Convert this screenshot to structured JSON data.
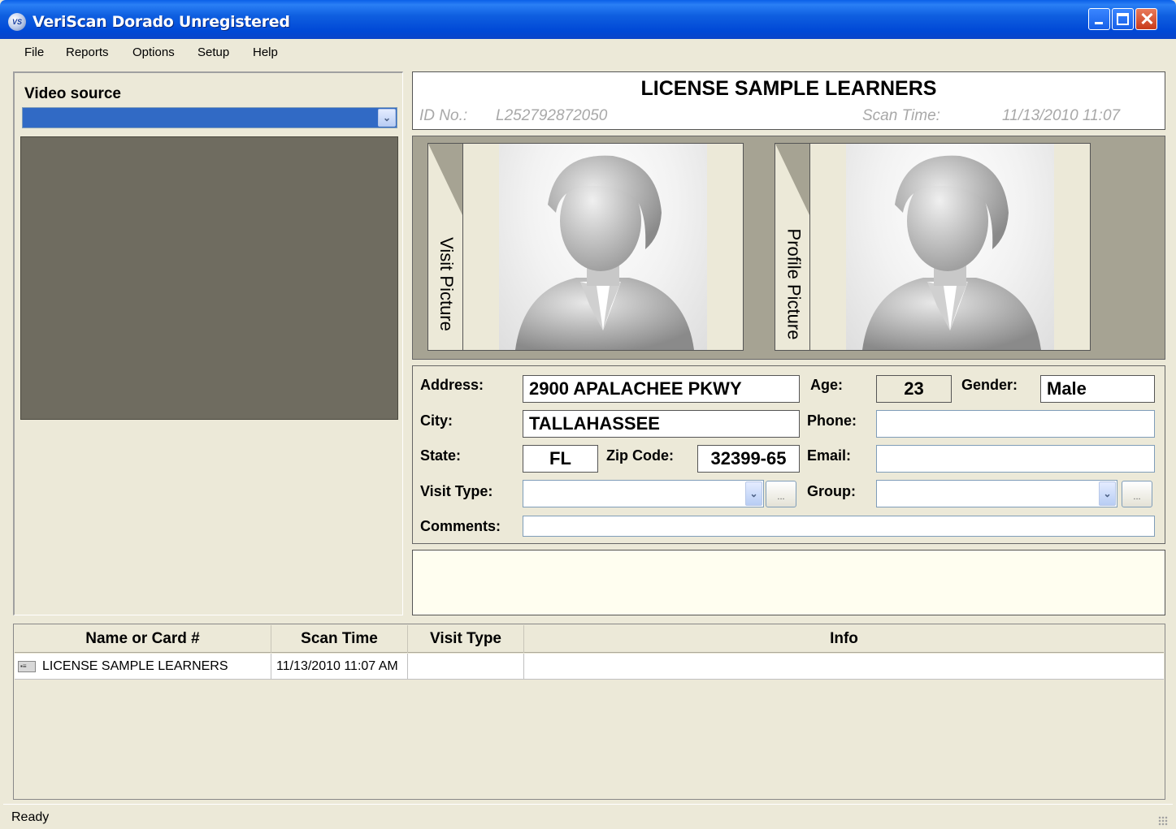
{
  "window": {
    "title": "VeriScan Dorado Unregistered",
    "icon_text": "VS",
    "icon": "app-logo-icon"
  },
  "menu": [
    "File",
    "Reports",
    "Options",
    "Setup",
    "Help"
  ],
  "video": {
    "label": "Video source",
    "selected": ""
  },
  "card": {
    "name": "LICENSE SAMPLE LEARNERS",
    "id_label": "ID No.:",
    "id_value": "L252792872050",
    "scan_label": "Scan Time:",
    "scan_value": "11/13/2010 11:07"
  },
  "pictures": {
    "visit_label": "Visit Picture",
    "profile_label": "Profile Picture"
  },
  "form": {
    "address_label": "Address:",
    "address_value": "2900 APALACHEE PKWY",
    "city_label": "City:",
    "city_value": "TALLAHASSEE",
    "state_label": "State:",
    "state_value": "FL",
    "zip_label": "Zip Code:",
    "zip_value": "32399-65",
    "age_label": "Age:",
    "age_value": "23",
    "gender_label": "Gender:",
    "gender_value": "Male",
    "phone_label": "Phone:",
    "phone_value": "",
    "email_label": "Email:",
    "email_value": "",
    "visit_type_label": "Visit Type:",
    "visit_type_value": "",
    "group_label": "Group:",
    "group_value": "",
    "comments_label": "Comments:",
    "comments_value": "",
    "dots": "..."
  },
  "list": {
    "columns": [
      "Name or Card #",
      "Scan Time",
      "Visit Type",
      "Info"
    ],
    "rows": [
      {
        "name": "LICENSE SAMPLE LEARNERS",
        "scan_time": "11/13/2010 11:07 AM",
        "visit_type": "",
        "info": "",
        "icon": "id-card-icon"
      }
    ]
  },
  "status": {
    "text": "Ready"
  },
  "colors": {
    "titlebar": "#0054e3",
    "window_bg": "#ece9d8",
    "video_bg": "#6f6c60",
    "combo_selected": "#316ac5",
    "pictures_bg": "#a6a393",
    "notes_bg": "#fffef0"
  }
}
